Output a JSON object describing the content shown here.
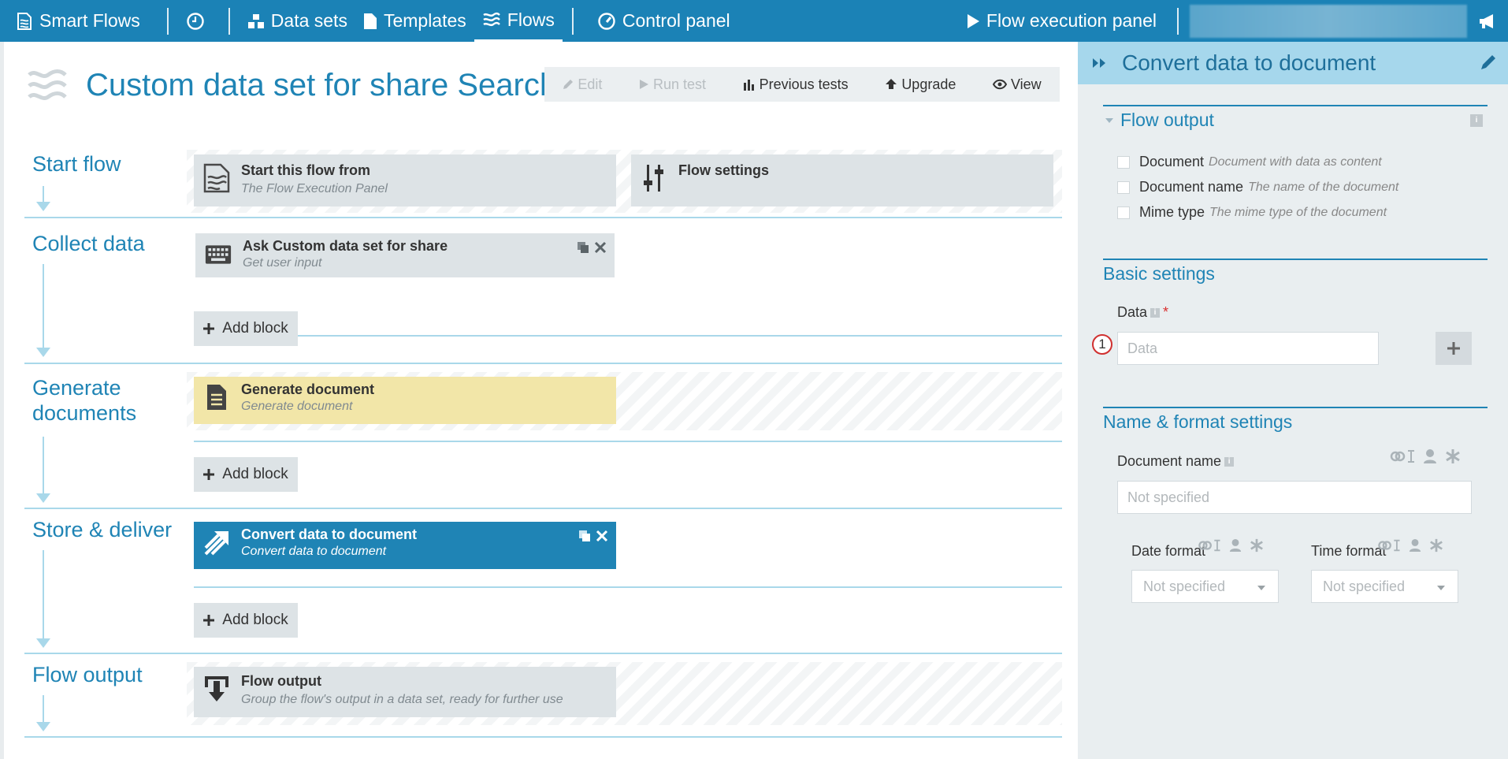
{
  "nav": {
    "brand": "Smart Flows",
    "datasets": "Data sets",
    "templates": "Templates",
    "flows": "Flows",
    "control_panel": "Control panel",
    "execution_panel": "Flow execution panel"
  },
  "page": {
    "title": "Custom data set for share Search"
  },
  "toolbar": {
    "edit": "Edit",
    "run_test": "Run test",
    "previous_tests": "Previous tests",
    "upgrade": "Upgrade",
    "view": "View"
  },
  "sections": {
    "start": {
      "title": "Start flow",
      "block1_title": "Start this flow from",
      "block1_sub": "The Flow Execution Panel",
      "block2_title": "Flow settings"
    },
    "collect": {
      "title": "Collect data",
      "block_title": "Ask Custom data set for share",
      "block_sub": "Get user input",
      "add": "Add block"
    },
    "generate": {
      "title_line1": "Generate",
      "title_line2": "documents",
      "block_title": "Generate document",
      "block_sub": "Generate document",
      "add": "Add block"
    },
    "store": {
      "title": "Store & deliver",
      "block_title": "Convert data to document",
      "block_sub": "Convert data to document",
      "add": "Add block"
    },
    "output": {
      "title": "Flow output",
      "block_title": "Flow output",
      "block_sub": "Group the flow's output in a data set, ready for further use"
    }
  },
  "panel": {
    "title": "Convert data to document",
    "flow_output": {
      "heading": "Flow output",
      "items": [
        {
          "label": "Document",
          "desc": "Document with data as content"
        },
        {
          "label": "Document name",
          "desc": "The name of the document"
        },
        {
          "label": "Mime type",
          "desc": "The mime type of the document"
        }
      ]
    },
    "basic": {
      "heading": "Basic settings",
      "data_label": "Data",
      "data_placeholder": "Data",
      "required_mark": "*",
      "marker": "1"
    },
    "name_format": {
      "heading": "Name & format settings",
      "doc_name_label": "Document name",
      "doc_name_placeholder": "Not specified",
      "date_format_label": "Date format",
      "date_format_value": "Not specified",
      "time_format_label": "Time format",
      "time_format_value": "Not specified"
    }
  },
  "colors": {
    "topbar": "#1b82b6",
    "accent": "#1f84b5",
    "panel_header": "#a6d7ec",
    "panel_bg": "#e9eef0",
    "block_grey": "#dde3e6",
    "block_yellow": "#f2e6a8",
    "required": "#d9302f"
  }
}
